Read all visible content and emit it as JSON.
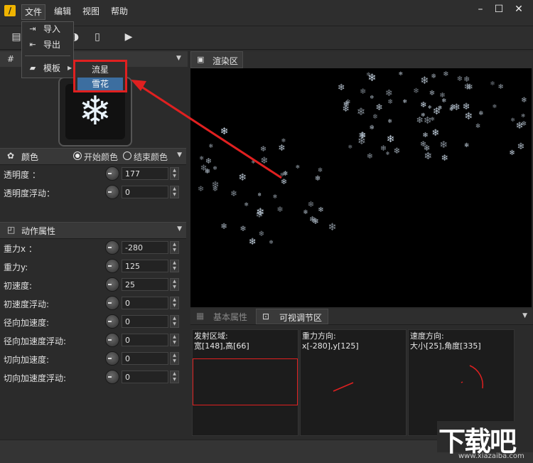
{
  "menubar": {
    "items": [
      "文件",
      "编辑",
      "视图",
      "帮助"
    ]
  },
  "file_menu": {
    "items": [
      {
        "label": "导入",
        "icon": "import-icon"
      },
      {
        "label": "导出",
        "icon": "export-icon"
      },
      {
        "label": "模板",
        "icon": "template-icon"
      }
    ]
  },
  "template_submenu": {
    "items": [
      "流星",
      "雪花"
    ],
    "highlighted": "雪花"
  },
  "color_section": {
    "title": "颜色",
    "start_color_label": "开始颜色",
    "end_color_label": "结束颜色",
    "props": [
      {
        "label": "透明度 ：",
        "value": "177"
      },
      {
        "label": "透明度浮动：",
        "value": "0"
      }
    ]
  },
  "motion_section": {
    "title": "动作属性",
    "props": [
      {
        "label": "重力x ：",
        "value": "-280"
      },
      {
        "label": "重力y:",
        "value": "125"
      },
      {
        "label": "初速度:",
        "value": "25"
      },
      {
        "label": "初速度浮动:",
        "value": "0"
      },
      {
        "label": "径向加速度:",
        "value": "0"
      },
      {
        "label": "径向加速度浮动:",
        "value": "0"
      },
      {
        "label": "切向加速度:",
        "value": "0"
      },
      {
        "label": "切向加速度浮动:",
        "value": "0"
      }
    ]
  },
  "render_panel": {
    "title": "渲染区"
  },
  "bottom_tabs": {
    "basic": "基本属性",
    "visual": "可视调节区"
  },
  "visual_boxes": [
    {
      "title": "发射区域:",
      "value": "宽[148],高[66]"
    },
    {
      "title": "重力方向:",
      "value": "x[-280],y[125]"
    },
    {
      "title": "速度方向:",
      "value": "大小[25],角度[335]"
    }
  ],
  "watermark": {
    "text": "下载吧",
    "url": "www.xiazaiba.com"
  },
  "colors": {
    "accent_red": "#e02020",
    "highlight_blue": "#3c6ea0",
    "app_icon": "#f0b400"
  }
}
